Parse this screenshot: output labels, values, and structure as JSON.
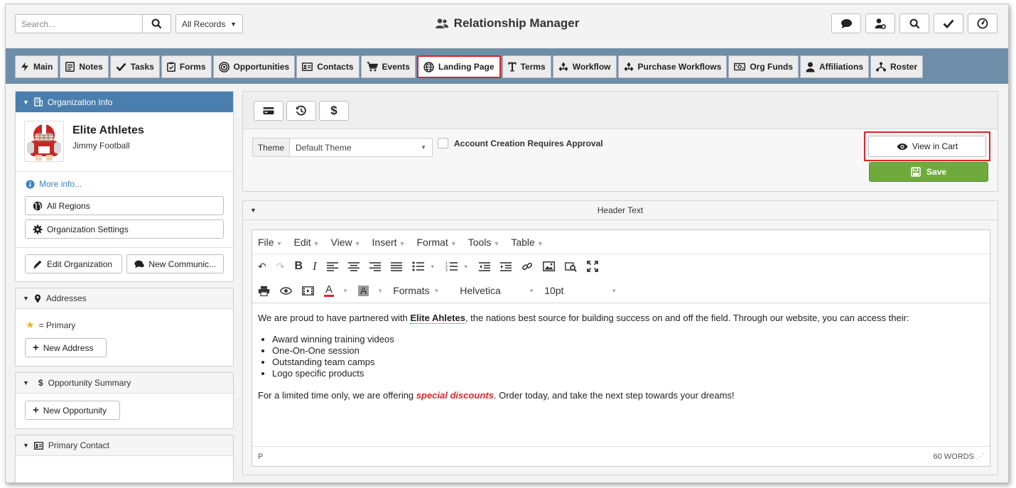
{
  "topbar": {
    "search_placeholder": "Search...",
    "records_label": "All Records",
    "app_title": "Relationship Manager"
  },
  "tabs": [
    {
      "label": "Main",
      "icon": "bolt-icon"
    },
    {
      "label": "Notes",
      "icon": "notes-icon"
    },
    {
      "label": "Tasks",
      "icon": "check-icon"
    },
    {
      "label": "Forms",
      "icon": "clipboard-icon"
    },
    {
      "label": "Opportunities",
      "icon": "target-icon"
    },
    {
      "label": "Contacts",
      "icon": "contact-card-icon"
    },
    {
      "label": "Events",
      "icon": "cart-icon"
    },
    {
      "label": "Landing Page",
      "icon": "globe-icon",
      "active": true
    },
    {
      "label": "Terms",
      "icon": "text-t-icon"
    },
    {
      "label": "Workflow",
      "icon": "workflow-icon"
    },
    {
      "label": "Purchase Workflows",
      "icon": "workflow-icon"
    },
    {
      "label": "Org Funds",
      "icon": "money-icon"
    },
    {
      "label": "Affiliations",
      "icon": "user-icon"
    },
    {
      "label": "Roster",
      "icon": "sitemap-icon"
    }
  ],
  "left": {
    "org_info_title": "Organization Info",
    "org_name": "Elite Athletes",
    "org_contact": "Jimmy Football",
    "more_info": "More info...",
    "all_regions": "All Regions",
    "org_settings": "Organization Settings",
    "edit_org": "Edit Organization",
    "new_comm": "New Communic...",
    "addresses_title": "Addresses",
    "primary_legend": "= Primary",
    "new_address": "New Address",
    "opportunity_title": "Opportunity Summary",
    "new_opportunity": "New Opportunity",
    "primary_contact_title": "Primary Contact"
  },
  "settings": {
    "theme_label": "Theme",
    "theme_value": "Default Theme",
    "approval_label": "Account Creation Requires Approval",
    "view_cart": "View in Cart",
    "save": "Save"
  },
  "editor": {
    "section_title": "Header Text",
    "menu": [
      "File",
      "Edit",
      "View",
      "Insert",
      "Format",
      "Tools",
      "Table"
    ],
    "formats_label": "Formats",
    "font_family": "Helvetica",
    "font_size": "10pt",
    "p1_before": "We are proud to have partnered with ",
    "p1_bold": "Elite Ahletes",
    "p1_after": ", the nations best source for building success on and off the field. Through our website, you can access their:",
    "bullets": [
      "Award winning training videos",
      "One-On-One session",
      "Outstanding team camps",
      "Logo specific products"
    ],
    "p2_before": "For a limited time only, we are offering ",
    "p2_em": "special discounts",
    "p2_after": ". Order today, and take the next step towards your dreams!",
    "status_path": "P",
    "word_count": "60 WORDS"
  },
  "colors": {
    "tabbar": "#6e8da9",
    "panel_head_blue": "#4a7eae",
    "highlight_red": "#d9262c",
    "save_green": "#6fab3c",
    "link_blue": "#3b82c4"
  }
}
